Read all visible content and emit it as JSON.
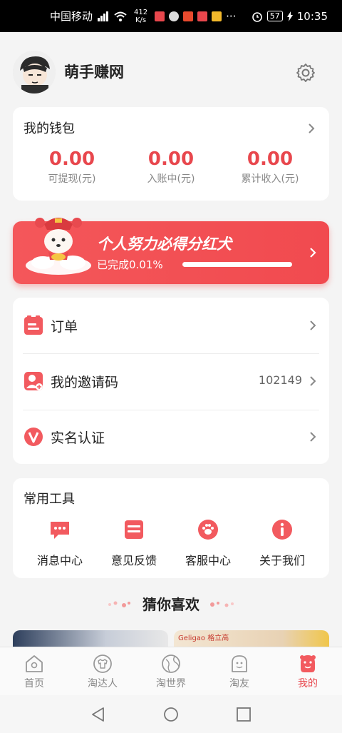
{
  "status_bar": {
    "carrier": "中国移动",
    "network_speed_value": "412",
    "network_speed_unit": "K/s",
    "battery": "57",
    "time": "10:35"
  },
  "profile": {
    "username": "萌手赚网"
  },
  "wallet": {
    "title": "我的钱包",
    "stats": [
      {
        "value": "0.00",
        "label": "可提现(元)"
      },
      {
        "value": "0.00",
        "label": "入账中(元)"
      },
      {
        "value": "0.00",
        "label": "累计收入(元)"
      }
    ]
  },
  "banner": {
    "title": "个人努力必得分红犬",
    "progress_text": "已完成0.01%",
    "progress_fraction": 0.0001,
    "accent_color": "#f14a4f"
  },
  "menu": {
    "items": [
      {
        "label": "订单",
        "value": "",
        "icon": "order-icon"
      },
      {
        "label": "我的邀请码",
        "value": "102149",
        "icon": "invite-code-icon"
      },
      {
        "label": "实名认证",
        "value": "",
        "icon": "verify-icon"
      }
    ]
  },
  "tools": {
    "title": "常用工具",
    "items": [
      {
        "label": "消息中心",
        "icon": "message-icon"
      },
      {
        "label": "意见反馈",
        "icon": "feedback-icon"
      },
      {
        "label": "客服中心",
        "icon": "customer-service-icon"
      },
      {
        "label": "关于我们",
        "icon": "info-icon"
      }
    ]
  },
  "recommend": {
    "title": "猜你喜欢",
    "brand_text": "Geligao 格立高"
  },
  "tabs": [
    {
      "label": "首页",
      "icon": "home-icon"
    },
    {
      "label": "淘达人",
      "icon": "shirt-icon"
    },
    {
      "label": "淘世界",
      "icon": "globe-icon"
    },
    {
      "label": "淘友",
      "icon": "friend-icon"
    },
    {
      "label": "我的",
      "icon": "me-icon",
      "active": true
    }
  ],
  "colors": {
    "accent": "#e8474d",
    "background": "#f4f4f4"
  }
}
